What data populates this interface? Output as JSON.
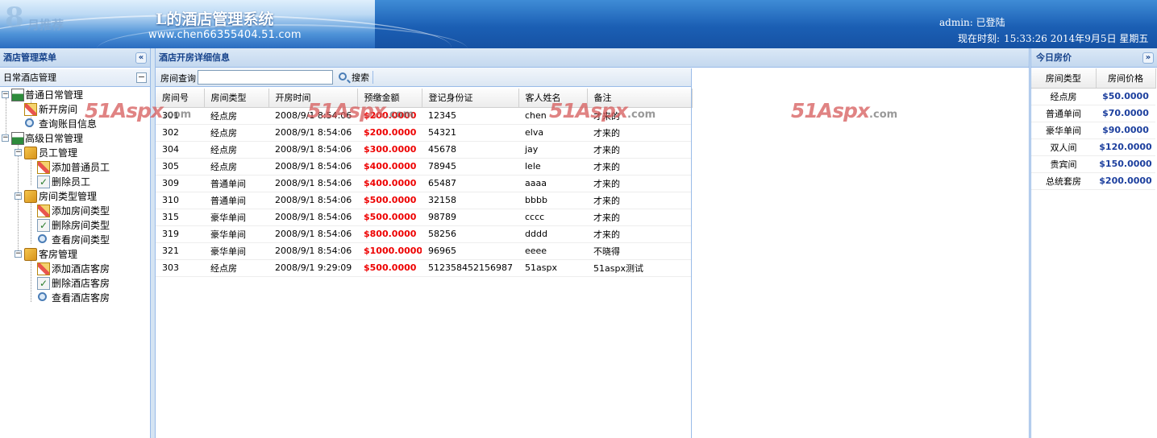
{
  "header": {
    "logo_mark": "8",
    "logo_text": "月推荐",
    "title": "L的酒店管理系统",
    "url": "www.chen66355404.51.com",
    "user_status": "admin: 已登陆",
    "clock_label": "现在时刻:",
    "clock_value": "15:33:26 2014年9月5日 星期五"
  },
  "left_panel": {
    "title": "酒店管理菜单",
    "collapse_icon": "«",
    "accordion_title": "日常酒店管理",
    "accordion_toggle": "−",
    "tree": [
      {
        "label": "普通日常管理",
        "icon": "tree-icon"
      },
      {
        "label": "新开房间",
        "icon": "pencil-icon"
      },
      {
        "label": "查询账目信息",
        "icon": "magnifier-icon"
      },
      {
        "label": "高级日常管理",
        "icon": "tree-icon"
      },
      {
        "label": "员工管理",
        "icon": "folder-icon"
      },
      {
        "label": "添加普通员工",
        "icon": "pencil-icon"
      },
      {
        "label": "删除员工",
        "icon": "doc-icon"
      },
      {
        "label": "房间类型管理",
        "icon": "folder-icon"
      },
      {
        "label": "添加房间类型",
        "icon": "pencil-icon"
      },
      {
        "label": "删除房间类型",
        "icon": "doc-icon"
      },
      {
        "label": "查看房间类型",
        "icon": "magnifier-icon"
      },
      {
        "label": "客房管理",
        "icon": "folder-icon"
      },
      {
        "label": "添加酒店客房",
        "icon": "pencil-icon"
      },
      {
        "label": "删除酒店客房",
        "icon": "doc-icon"
      },
      {
        "label": "查看酒店客房",
        "icon": "magnifier-icon"
      }
    ]
  },
  "center_panel": {
    "title": "酒店开房详细信息",
    "search_label": "房间查询",
    "search_value": "",
    "search_button": "搜索",
    "columns": [
      "房间号",
      "房间类型",
      "开房时间",
      "预缴金额",
      "登记身份证",
      "客人姓名",
      "备注"
    ],
    "rows": [
      [
        "301",
        "经点房",
        "2008/9/1 8:54:06",
        "$200.0000",
        "12345",
        "chen",
        "才来的"
      ],
      [
        "302",
        "经点房",
        "2008/9/1 8:54:06",
        "$200.0000",
        "54321",
        "elva",
        "才来的"
      ],
      [
        "304",
        "经点房",
        "2008/9/1 8:54:06",
        "$300.0000",
        "45678",
        "jay",
        "才来的"
      ],
      [
        "305",
        "经点房",
        "2008/9/1 8:54:06",
        "$400.0000",
        "78945",
        "lele",
        "才来的"
      ],
      [
        "309",
        "普通单间",
        "2008/9/1 8:54:06",
        "$400.0000",
        "65487",
        "aaaa",
        "才来的"
      ],
      [
        "310",
        "普通单间",
        "2008/9/1 8:54:06",
        "$500.0000",
        "32158",
        "bbbb",
        "才来的"
      ],
      [
        "315",
        "豪华单间",
        "2008/9/1 8:54:06",
        "$500.0000",
        "98789",
        "cccc",
        "才来的"
      ],
      [
        "319",
        "豪华单间",
        "2008/9/1 8:54:06",
        "$800.0000",
        "58256",
        "dddd",
        "才来的"
      ],
      [
        "321",
        "豪华单间",
        "2008/9/1 8:54:06",
        "$1000.0000",
        "96965",
        "eeee",
        "不晓得"
      ],
      [
        "303",
        "经点房",
        "2008/9/1 9:29:09",
        "$500.0000",
        "512358452156987",
        "51aspx",
        "51aspx测试"
      ]
    ],
    "watermark_brand": "51Aspx",
    "watermark_suffix": ".com"
  },
  "right_panel": {
    "title": "今日房价",
    "expand_icon": "»",
    "columns": [
      "房间类型",
      "房间价格"
    ],
    "rows": [
      [
        "经点房",
        "$50.0000"
      ],
      [
        "普通单间",
        "$70.0000"
      ],
      [
        "豪华单间",
        "$90.0000"
      ],
      [
        "双人间",
        "$120.0000"
      ],
      [
        "贵宾间",
        "$150.0000"
      ],
      [
        "总统套房",
        "$200.0000"
      ]
    ]
  },
  "colors": {
    "header_blue": "#1b5fb4",
    "panel_border": "#99bbe8",
    "panel_title": "#15428b",
    "deposit_red": "#e00000",
    "price_blue": "#1c3f9e"
  }
}
